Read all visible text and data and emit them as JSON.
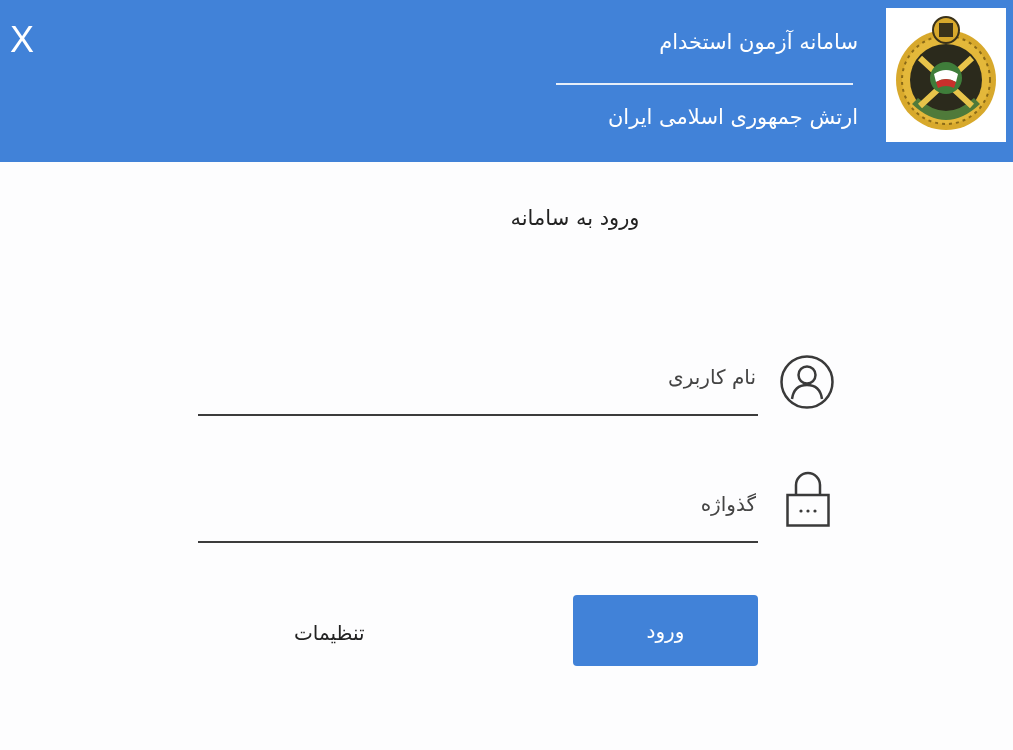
{
  "header": {
    "close": "X",
    "title": "سامانه آزمون استخدام",
    "subtitle": "ارتش جمهوری اسلامی ایران"
  },
  "login_title": "ورود به سامانه",
  "fields": [
    {
      "kind": "username",
      "placeholder": "نام کاربری"
    },
    {
      "kind": "password",
      "placeholder": "گذواژه"
    }
  ],
  "buttons": {
    "login": "ورود",
    "settings": "تنظیمات"
  }
}
